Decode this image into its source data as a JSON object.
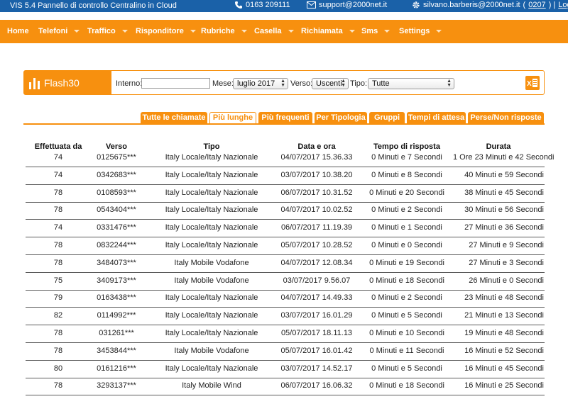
{
  "topbar": {
    "title": "VIS 5.4 Pannello di controllo Centralino in Cloud",
    "phone": "0163 209111",
    "email": "support@2000net.it",
    "user": "silvano.barberis@2000net.it",
    "user_code_open": " (",
    "user_code": "0207",
    "user_code_close": ") | ",
    "logout": "Logout",
    "phone_icon": "phone-icon",
    "mail_icon": "envelope-icon",
    "gear_icon": "gear-icon"
  },
  "menu": {
    "items": [
      {
        "label": "Home"
      },
      {
        "label": "Telefoni"
      },
      {
        "label": "Traffico"
      },
      {
        "label": "Risponditore"
      },
      {
        "label": "Rubriche"
      },
      {
        "label": "Casella"
      },
      {
        "label": "Richiamata"
      },
      {
        "label": "Sms"
      },
      {
        "label": "Settings"
      }
    ]
  },
  "filter": {
    "logo_text": "Flash30",
    "interno_label": "Interno:",
    "interno_value": "",
    "mese_label": "Mese:",
    "mese_value": "luglio 2017",
    "verso_label": "Verso:",
    "verso_value": "Uscenti",
    "tipo_label": "Tipo:",
    "tipo_value": "Tutte",
    "export_icon": "excel-export-icon"
  },
  "tabs": [
    {
      "label": "Tutte le chiamate"
    },
    {
      "label": "Più lunghe"
    },
    {
      "label": "Più frequenti"
    },
    {
      "label": "Per Tipologia"
    },
    {
      "label": "Gruppi"
    },
    {
      "label": "Tempi di attesa"
    },
    {
      "label": "Perse/Non risposte"
    }
  ],
  "active_tab": "Più lunghe",
  "table": {
    "headers": [
      "Effettuata da",
      "Verso",
      "Tipo",
      "Data e ora",
      "Tempo di risposta",
      "Durata"
    ],
    "rows": [
      [
        "74",
        "0125675***",
        "Italy Locale/Italy Nazionale",
        "04/07/2017 15.36.33",
        "0 Minuti e 7 Secondi",
        "1 Ore 23 Minuti e 42 Secondi"
      ],
      [
        "74",
        "0342683***",
        "Italy Locale/Italy Nazionale",
        "03/07/2017 10.38.20",
        "0 Minuti e 8 Secondi",
        "40 Minuti e 59 Secondi"
      ],
      [
        "78",
        "0108593***",
        "Italy Locale/Italy Nazionale",
        "06/07/2017 10.31.52",
        "0 Minuti e 20 Secondi",
        "38 Minuti e 45 Secondi"
      ],
      [
        "78",
        "0543404***",
        "Italy Locale/Italy Nazionale",
        "04/07/2017 10.02.52",
        "0 Minuti e 2 Secondi",
        "30 Minuti e 56 Secondi"
      ],
      [
        "74",
        "0331476***",
        "Italy Locale/Italy Nazionale",
        "06/07/2017 11.19.39",
        "0 Minuti e 1 Secondi",
        "27 Minuti e 36 Secondi"
      ],
      [
        "78",
        "0832244***",
        "Italy Locale/Italy Nazionale",
        "05/07/2017 10.28.52",
        "0 Minuti e 0 Secondi",
        "27 Minuti e 9 Secondi"
      ],
      [
        "78",
        "3484073***",
        "Italy Mobile Vodafone",
        "04/07/2017 12.08.34",
        "0 Minuti e 19 Secondi",
        "27 Minuti e 3 Secondi"
      ],
      [
        "75",
        "3409173***",
        "Italy Mobile Vodafone",
        "03/07/2017 9.56.07",
        "0 Minuti e 18 Secondi",
        "26 Minuti e 0 Secondi"
      ],
      [
        "79",
        "0163438***",
        "Italy Locale/Italy Nazionale",
        "04/07/2017 14.49.33",
        "0 Minuti e 2 Secondi",
        "23 Minuti e 48 Secondi"
      ],
      [
        "82",
        "0114992***",
        "Italy Locale/Italy Nazionale",
        "03/07/2017 16.01.29",
        "0 Minuti e 5 Secondi",
        "21 Minuti e 13 Secondi"
      ],
      [
        "78",
        "031261***",
        "Italy Locale/Italy Nazionale",
        "05/07/2017 18.11.13",
        "0 Minuti e 10 Secondi",
        "19 Minuti e 48 Secondi"
      ],
      [
        "78",
        "3453844***",
        "Italy Mobile Vodafone",
        "05/07/2017 16.01.42",
        "0 Minuti e 11 Secondi",
        "16 Minuti e 52 Secondi"
      ],
      [
        "80",
        "0161216***",
        "Italy Locale/Italy Nazionale",
        "03/07/2017 14.52.17",
        "0 Minuti e 5 Secondi",
        "16 Minuti e 45 Secondi"
      ],
      [
        "78",
        "3293137***",
        "Italy Mobile Wind",
        "06/07/2017 16.06.32",
        "0 Minuti e 18 Secondi",
        "16 Minuti e 25 Secondi"
      ]
    ]
  },
  "colors": {
    "topbar": "#1a61a8",
    "accent": "#f7900f"
  }
}
